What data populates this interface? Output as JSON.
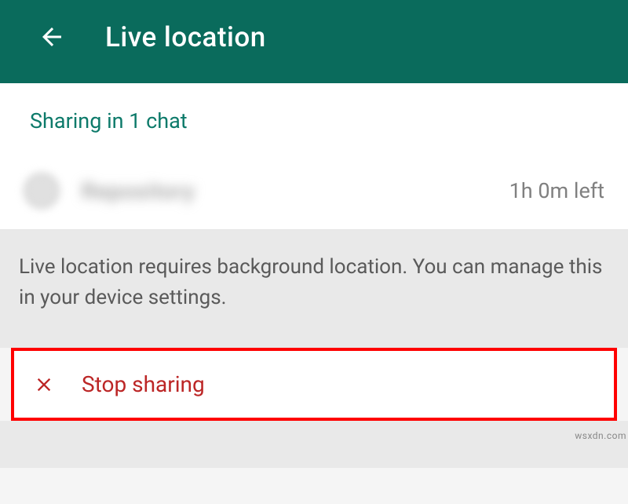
{
  "header": {
    "title": "Live location"
  },
  "sharing": {
    "status": "Sharing in 1 chat"
  },
  "chat": {
    "name": "Repository",
    "timeLeft": "1h 0m left"
  },
  "info": {
    "text": "Live location requires background location. You can manage this in your device settings."
  },
  "actions": {
    "stopSharing": "Stop sharing"
  },
  "watermark": "wsxdn.com"
}
